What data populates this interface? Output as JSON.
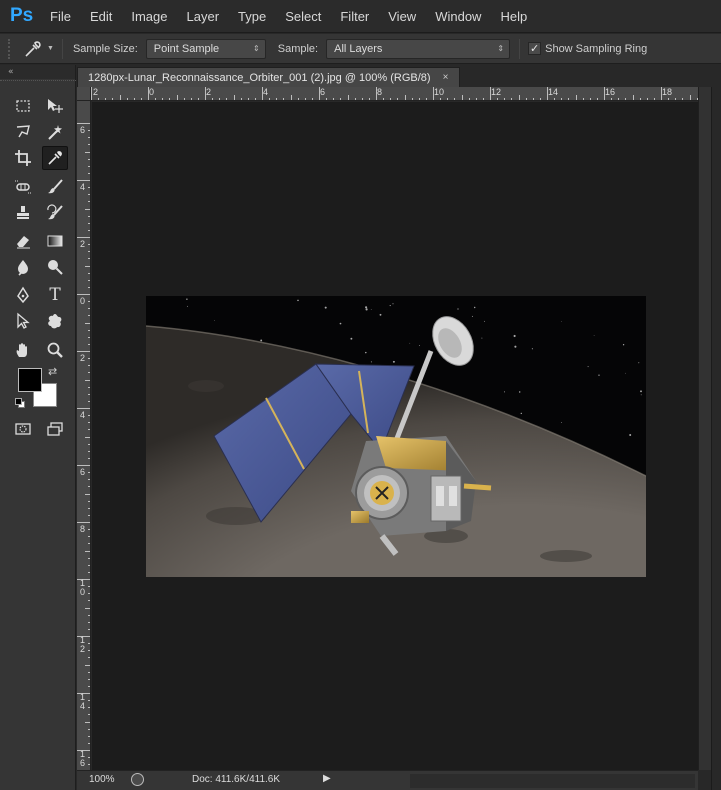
{
  "app": {
    "logo": "Ps"
  },
  "menu": [
    "File",
    "Edit",
    "Image",
    "Layer",
    "Type",
    "Select",
    "Filter",
    "View",
    "Window",
    "Help"
  ],
  "options": {
    "sample_size_label": "Sample Size:",
    "sample_size_value": "Point Sample",
    "sample_label": "Sample:",
    "sample_value": "All Layers",
    "show_ring_label": "Show Sampling Ring",
    "show_ring_checked": true
  },
  "document": {
    "tab_title": "1280px-Lunar_Reconnaissance_Orbiter_001 (2).jpg @ 100% (RGB/8)",
    "close_glyph": "×"
  },
  "rulers": {
    "horizontal": [
      "2",
      "0",
      "2",
      "4",
      "6",
      "8",
      "10",
      "12",
      "14",
      "16",
      "18"
    ],
    "vertical": [
      "6",
      "4",
      "2",
      "0",
      "2",
      "4",
      "6",
      "8",
      "1\n0",
      "1\n2",
      "1\n4",
      "1\n6"
    ]
  },
  "status": {
    "zoom": "100%",
    "doc_info": "Doc: 411.6K/411.6K"
  },
  "toolbox": {
    "collapse_glyph": "«",
    "tools": [
      {
        "name": "rectangular-marquee-icon"
      },
      {
        "name": "move-icon"
      },
      {
        "name": "lasso-icon"
      },
      {
        "name": "magic-wand-icon"
      },
      {
        "name": "crop-icon"
      },
      {
        "name": "eyedropper-icon"
      },
      {
        "name": "spot-healing-icon"
      },
      {
        "name": "brush-icon"
      },
      {
        "name": "clone-stamp-icon"
      },
      {
        "name": "history-brush-icon"
      },
      {
        "name": "eraser-icon"
      },
      {
        "name": "gradient-icon"
      },
      {
        "name": "blur-icon"
      },
      {
        "name": "dodge-icon"
      },
      {
        "name": "pen-icon"
      },
      {
        "name": "type-icon"
      },
      {
        "name": "path-selection-icon"
      },
      {
        "name": "custom-shape-icon"
      },
      {
        "name": "hand-icon"
      },
      {
        "name": "zoom-icon"
      }
    ],
    "foreground_color": "#000000",
    "background_color": "#ffffff",
    "type_tool_glyph": "T"
  },
  "colors": {
    "accent": "#31a8ff",
    "canvas_bg": "#1c1c1c"
  }
}
